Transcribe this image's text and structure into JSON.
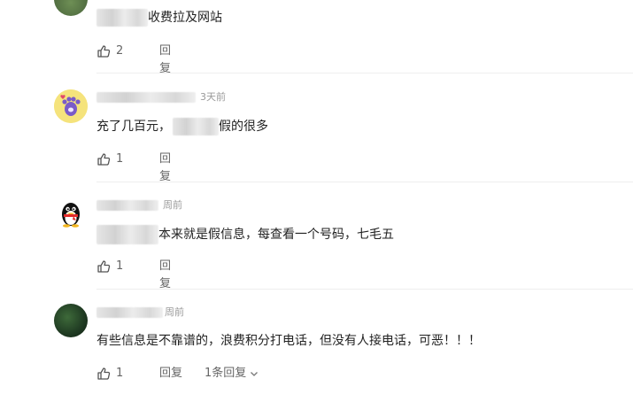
{
  "comments": [
    {
      "avatar": "green-avatar-partial",
      "username": "",
      "time": "",
      "text": "收费拉及网站",
      "likes": "2",
      "reply_label": "回复"
    },
    {
      "avatar": "purple-paw-avatar",
      "username": "",
      "time": "3天前",
      "text_prefix": "充了几百元，",
      "text_suffix": "假的很多",
      "likes": "1",
      "reply_label": "回复"
    },
    {
      "avatar": "qq-penguin-avatar",
      "username": "",
      "time": "周前",
      "text": "本来就是假信息，每查看一个号码，七毛五",
      "likes": "1",
      "reply_label": "回复"
    },
    {
      "avatar": "dark-green-game-avatar",
      "username": "",
      "time": "周前",
      "text": "有些信息是不靠谱的，浪费积分打电话，但没有人接电话，可恶！！！",
      "likes": "1",
      "reply_label": "回复",
      "replies_label": "1条回复"
    }
  ],
  "icons": {
    "like": "thumbs-up-icon",
    "expand": "chevron-down-icon"
  }
}
